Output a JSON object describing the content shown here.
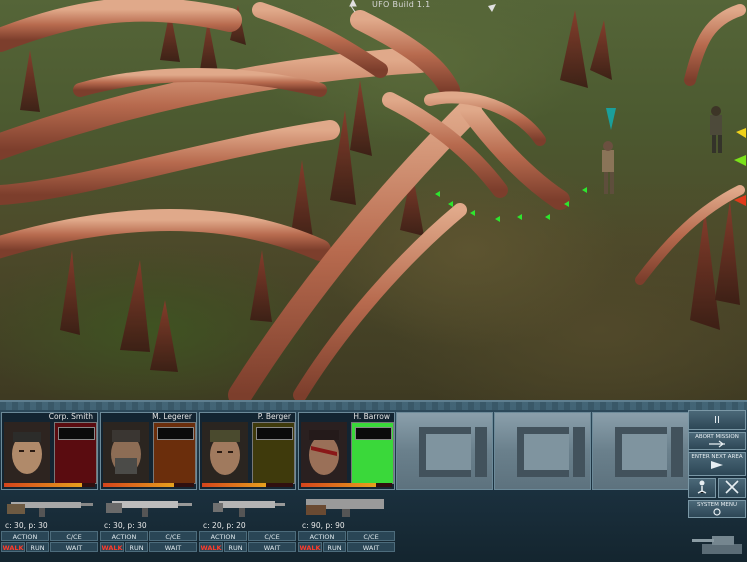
{
  "build_label": "UFO Build 1.1",
  "squad": [
    {
      "name": "Corp. Smith",
      "rank_color": "#5a0c10",
      "health": 0.86,
      "ammo_c": "c:",
      "ammo_c_val": "30,",
      "ammo_p": "p:",
      "ammo_p_val": "30",
      "skin": "#b08a6a"
    },
    {
      "name": "M. Legerer",
      "rank_color": "#6b2e0c",
      "health": 0.78,
      "ammo_c": "c:",
      "ammo_c_val": "30,",
      "ammo_p": "p:",
      "ammo_p_val": "30",
      "skin": "#8d6d55"
    },
    {
      "name": "P. Berger",
      "rank_color": "#3f3a0c",
      "health": 0.7,
      "ammo_c": "c:",
      "ammo_c_val": "20,",
      "ammo_p": "p:",
      "ammo_p_val": "20",
      "skin": "#a07a5e"
    },
    {
      "name": "H. Barrow",
      "rank_color": "#3ad83a",
      "health": 0.82,
      "ammo_c": "c:",
      "ammo_c_val": "90,",
      "ammo_p": "p:",
      "ammo_p_val": "90",
      "skin": "#9a7058"
    }
  ],
  "actions": {
    "action": "ACTION",
    "cce": "C/CE",
    "walk": "WALK",
    "run": "RUN",
    "wait": "WAIT"
  },
  "side": {
    "pause": "II",
    "abort": "ABORT MISSION",
    "next_area": "ENTER NEXT AREA",
    "system_menu": "SYSTEM MENU"
  },
  "colors": {
    "hud_bg": "#1d3443",
    "selected_rank": "#3ad83a",
    "marker": "#2ee62e"
  }
}
